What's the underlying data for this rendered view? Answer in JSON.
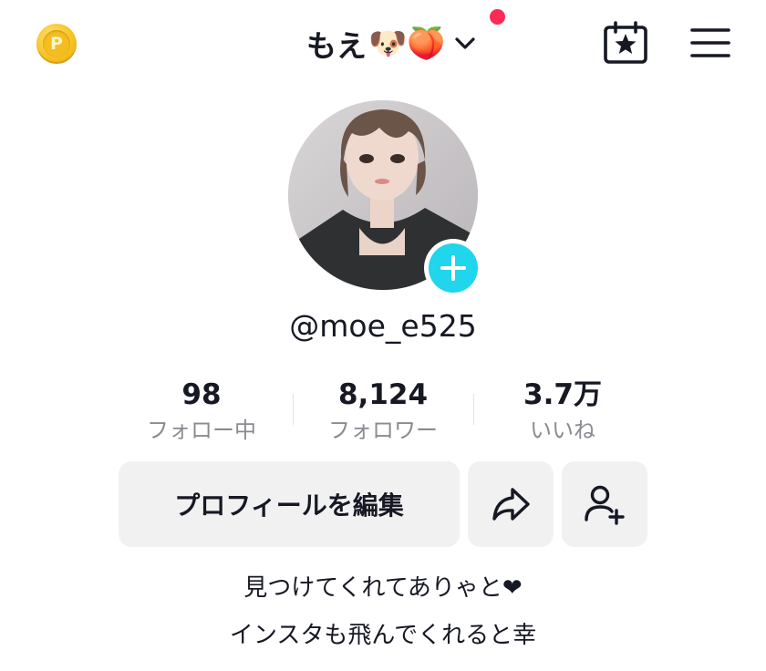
{
  "header": {
    "coin_letter": "P",
    "display_name": "もえ",
    "name_emojis": "🐶🍑"
  },
  "profile": {
    "username": "@moe_e525"
  },
  "stats": [
    {
      "value": "98",
      "label": "フォロー中"
    },
    {
      "value": "8,124",
      "label": "フォロワー"
    },
    {
      "value": "3.7万",
      "label": "いいね"
    }
  ],
  "actions": {
    "edit_profile_label": "プロフィールを編集"
  },
  "bio": {
    "line1": "見つけてくれてありゃと❤",
    "line2": "インスタも飛んでくれると幸"
  },
  "colors": {
    "accent_cyan": "#20d5ec",
    "notification_red": "#fe2c55",
    "button_bg": "#f1f1f2",
    "text_primary": "#161823",
    "text_secondary": "#8a8b91"
  },
  "icons": [
    "coin-icon",
    "chevron-down-icon",
    "calendar-star-icon",
    "menu-icon",
    "plus-icon",
    "share-icon",
    "add-friend-icon"
  ]
}
